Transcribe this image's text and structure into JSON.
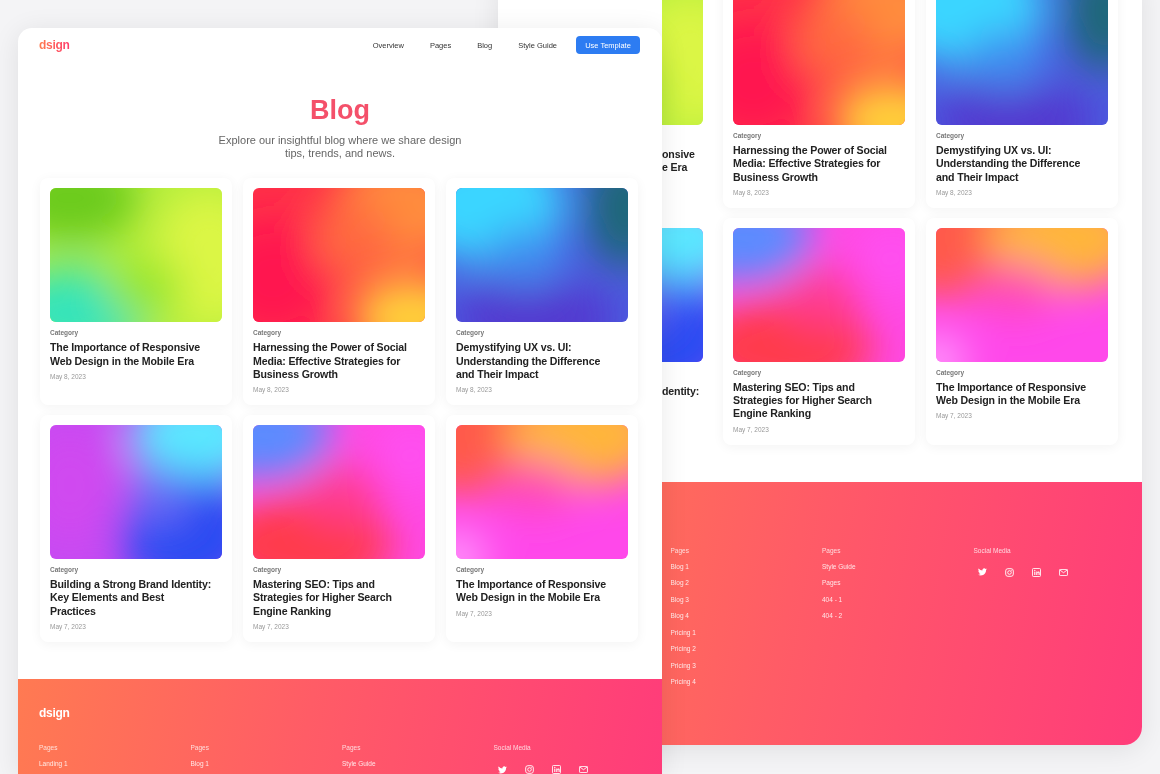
{
  "back_page": {
    "cards": [
      {
        "kind": "partial",
        "title": "onsive\ne Era"
      },
      {
        "kind": "full",
        "category": "Category",
        "title": "Harnessing the Power of Social Media: Effective Strategies for Business Growth",
        "date": "May 8, 2023"
      },
      {
        "kind": "full",
        "category": "Category",
        "title": "Demystifying UX vs. UI: Understanding the Difference and Their Impact",
        "date": "May 8, 2023"
      },
      {
        "kind": "partial",
        "title": "dentity:"
      },
      {
        "kind": "full",
        "category": "Category",
        "title": "Mastering SEO: Tips and Strategies for Higher Search Engine Ranking",
        "date": "May 7, 2023"
      },
      {
        "kind": "full",
        "category": "Category",
        "title": "The Importance of Responsive Web Design in the Mobile Era",
        "date": "May 7, 2023"
      }
    ],
    "footer": {
      "columns": [
        {
          "kind": "links",
          "heading": "Pages",
          "links": [
            "Blog 1",
            "Blog 2",
            "Blog 3",
            "Blog 4",
            "Pricing 1",
            "Pricing 2",
            "Pricing 3",
            "Pricing 4"
          ]
        },
        {
          "kind": "links",
          "heading": "Pages",
          "links": [
            "Style Guide",
            "Pages",
            "404 - 1",
            "404 - 2"
          ]
        },
        {
          "kind": "social",
          "heading": "Social Media",
          "icons": [
            {
              "kind": "twitter"
            },
            {
              "kind": "instagram"
            },
            {
              "kind": "linkedin"
            },
            {
              "kind": "mail"
            }
          ]
        }
      ]
    }
  },
  "front_page": {
    "logo": "dsign",
    "nav": [
      {
        "label": "Overview"
      },
      {
        "label": "Pages"
      },
      {
        "label": "Blog"
      },
      {
        "label": "Style Guide"
      }
    ],
    "cta": "Use Template",
    "title": "Blog",
    "subtitle": "Explore our insightful blog where we share design tips, trends, and news.",
    "cards": [
      {
        "kind": "full",
        "category": "Category",
        "title": "The Importance of Responsive Web Design in the Mobile Era",
        "date": "May 8, 2023"
      },
      {
        "kind": "full",
        "category": "Category",
        "title": "Harnessing the Power of Social Media: Effective Strategies for Business Growth",
        "date": "May 8, 2023"
      },
      {
        "kind": "full",
        "category": "Category",
        "title": "Demystifying UX vs. UI: Understanding the Difference and Their Impact",
        "date": "May 8, 2023"
      },
      {
        "kind": "full",
        "category": "Category",
        "title": "Building a Strong Brand Identity: Key Elements and Best Practices",
        "date": "May 7, 2023"
      },
      {
        "kind": "full",
        "category": "Category",
        "title": "Mastering SEO: Tips and Strategies for Higher Search Engine Ranking",
        "date": "May 7, 2023"
      },
      {
        "kind": "full",
        "category": "Category",
        "title": "The Importance of Responsive Web Design in the Mobile Era",
        "date": "May 7, 2023"
      }
    ],
    "footer": {
      "logo": "dsign",
      "columns": [
        {
          "kind": "links",
          "heading": "Pages",
          "links": [
            "Landing 1"
          ]
        },
        {
          "kind": "links",
          "heading": "Pages",
          "links": [
            "Blog 1"
          ]
        },
        {
          "kind": "links",
          "heading": "Pages",
          "links": [
            "Style Guide"
          ]
        },
        {
          "kind": "social",
          "heading": "Social Media",
          "icons": [
            {
              "kind": "twitter"
            },
            {
              "kind": "instagram"
            },
            {
              "kind": "linkedin"
            },
            {
              "kind": "mail"
            }
          ]
        }
      ]
    }
  }
}
